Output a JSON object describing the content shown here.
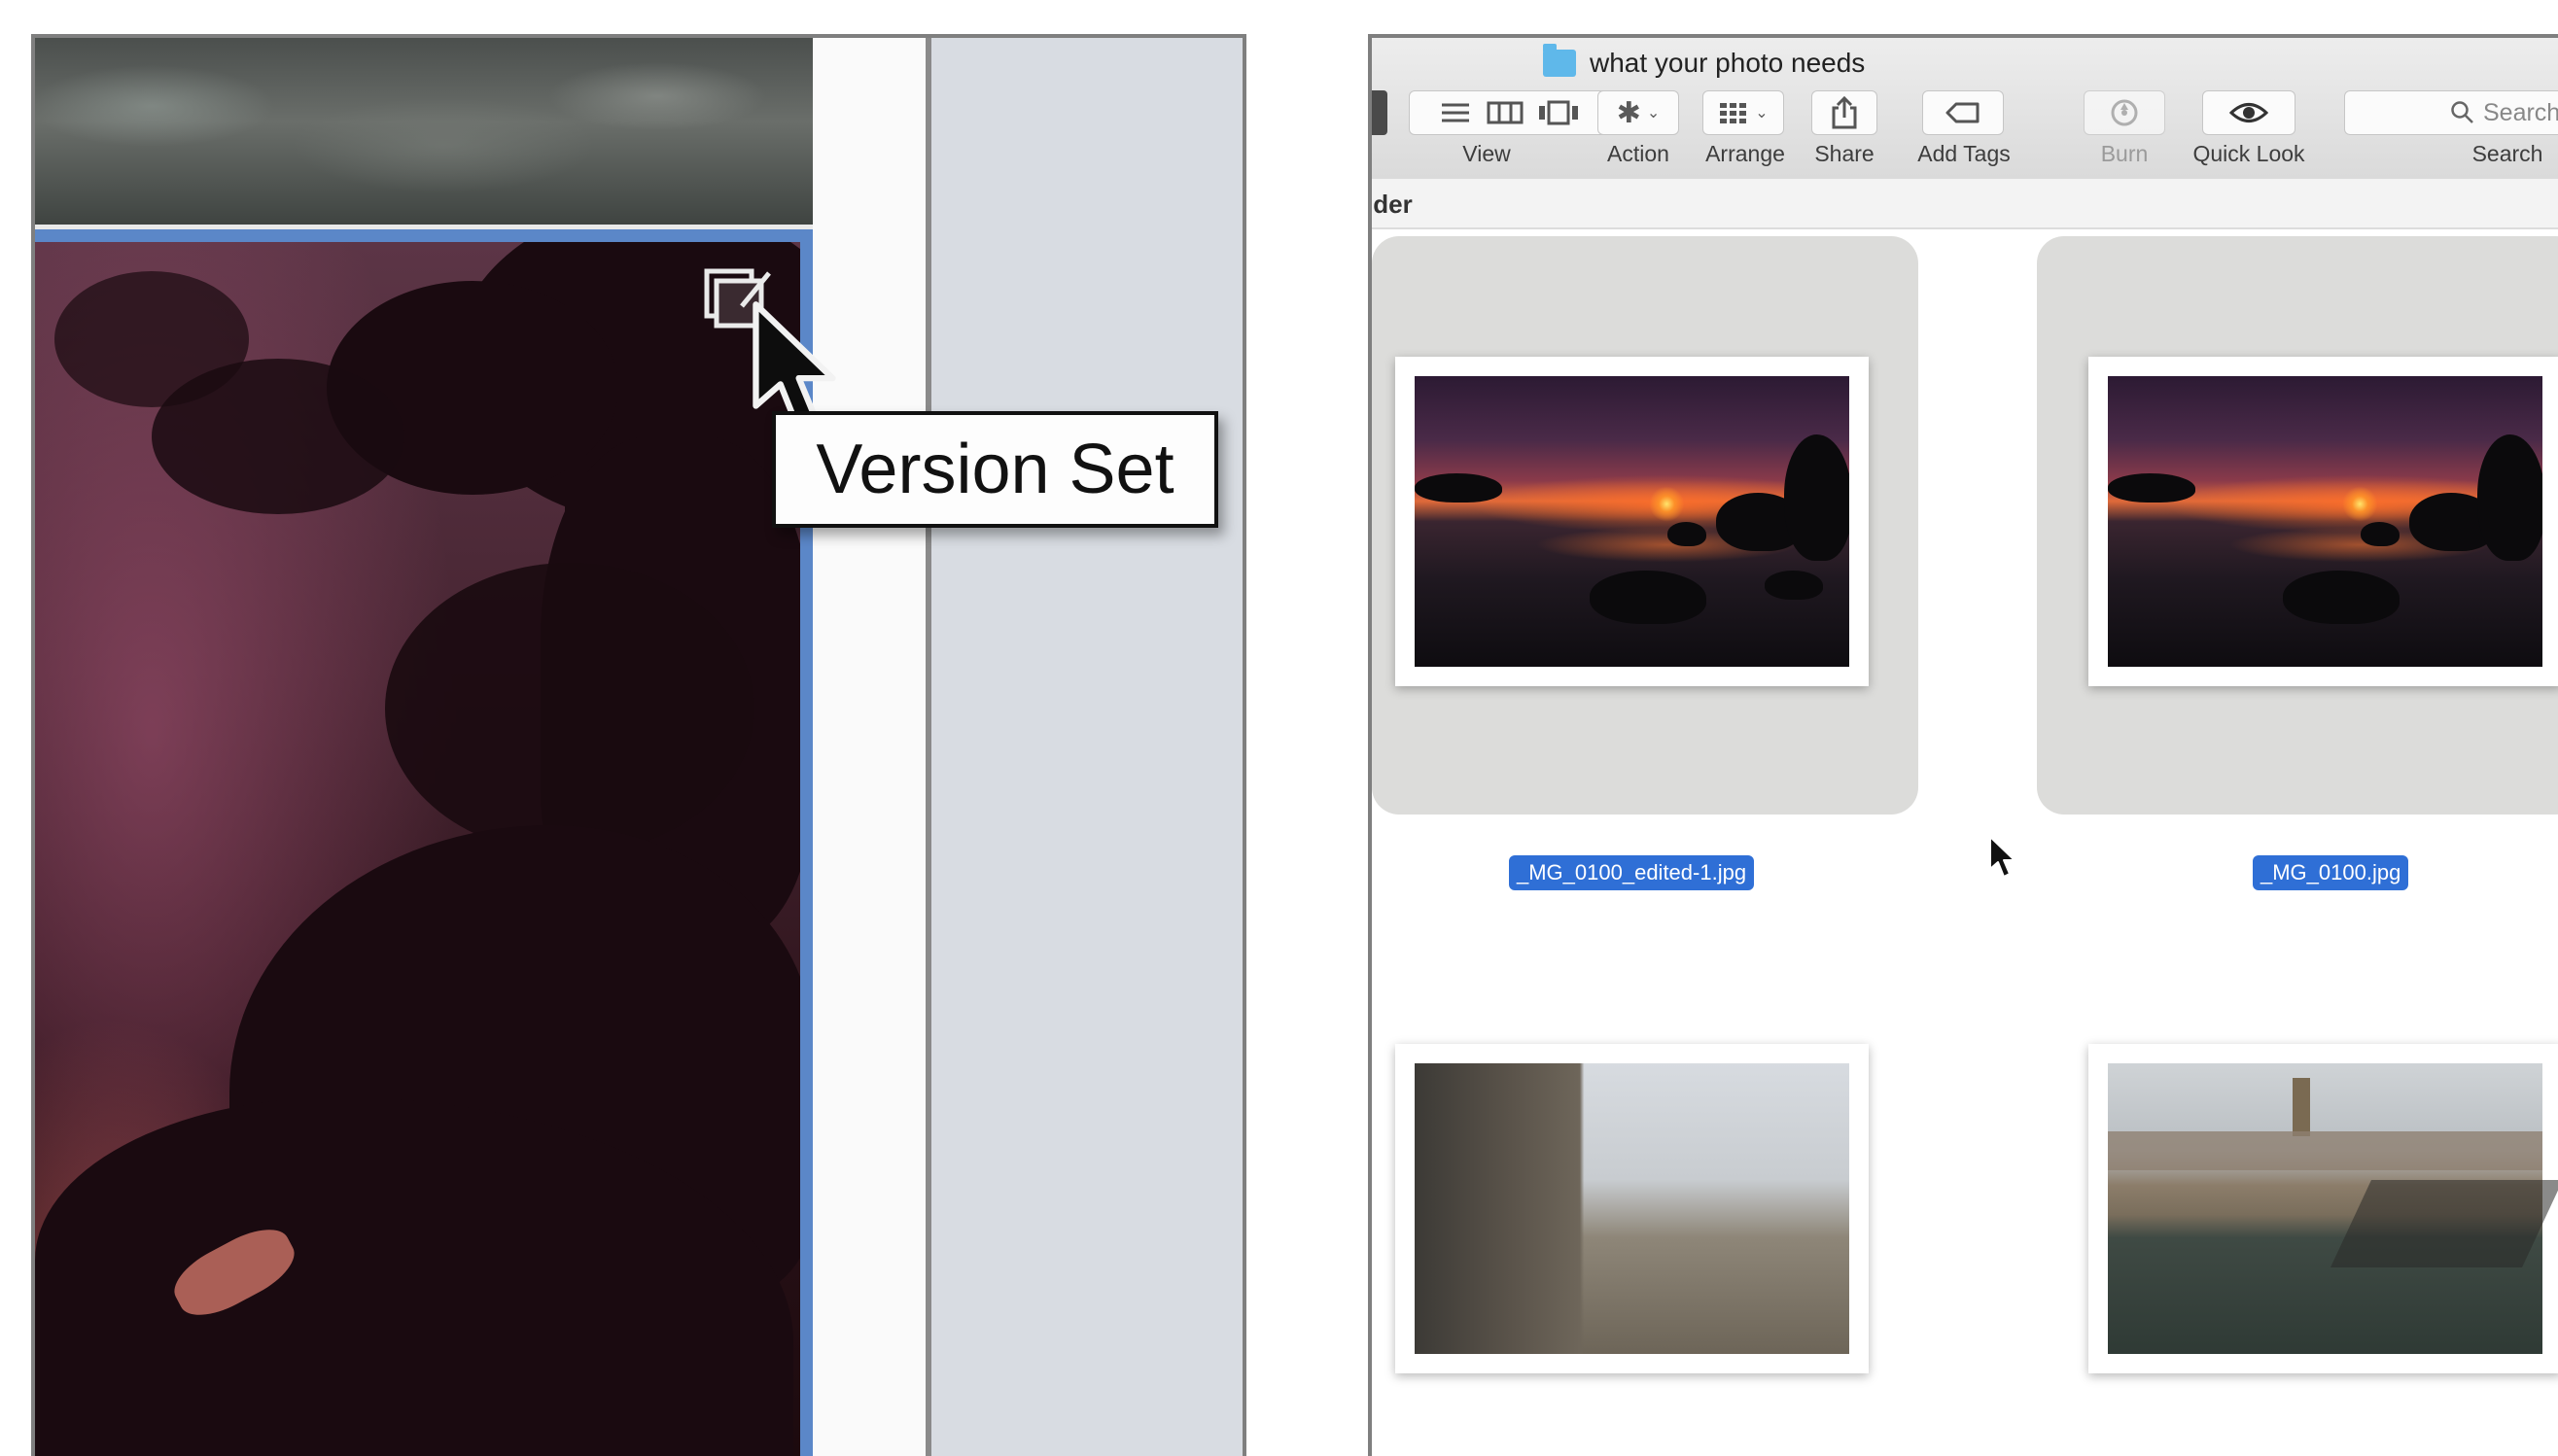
{
  "left_panel": {
    "tooltip": "Version Set",
    "icons": {
      "version_set": "version-set-icon",
      "cursor": "arrow-cursor-icon"
    }
  },
  "finder": {
    "window_title": "what your photo needs",
    "path_label": "lder",
    "toolbar": [
      {
        "name": "View",
        "icons": [
          "list-view-icon",
          "column-view-icon",
          "cover-flow-icon"
        ]
      },
      {
        "name": "Action",
        "icon": "gear-icon"
      },
      {
        "name": "Arrange",
        "icon": "grid-icon"
      },
      {
        "name": "Share",
        "icon": "share-icon"
      },
      {
        "name": "Add Tags",
        "icon": "tag-icon"
      },
      {
        "name": "Burn",
        "icon": "burn-icon",
        "disabled": true
      },
      {
        "name": "Quick Look",
        "icon": "eye-icon"
      },
      {
        "name": "Search",
        "icon": "search-icon",
        "placeholder": "Search"
      }
    ],
    "files": [
      {
        "filename": "_MG_0100_edited-1.jpg",
        "selected": true
      },
      {
        "filename": "_MG_0100.jpg",
        "selected": true
      },
      {
        "filename": "",
        "selected": false
      },
      {
        "filename": "",
        "selected": false
      }
    ]
  },
  "colors": {
    "selection_blue": "#2f6fd6",
    "organizer_select_border": "#5b87c8",
    "panel_grey": "#d8dce2"
  }
}
